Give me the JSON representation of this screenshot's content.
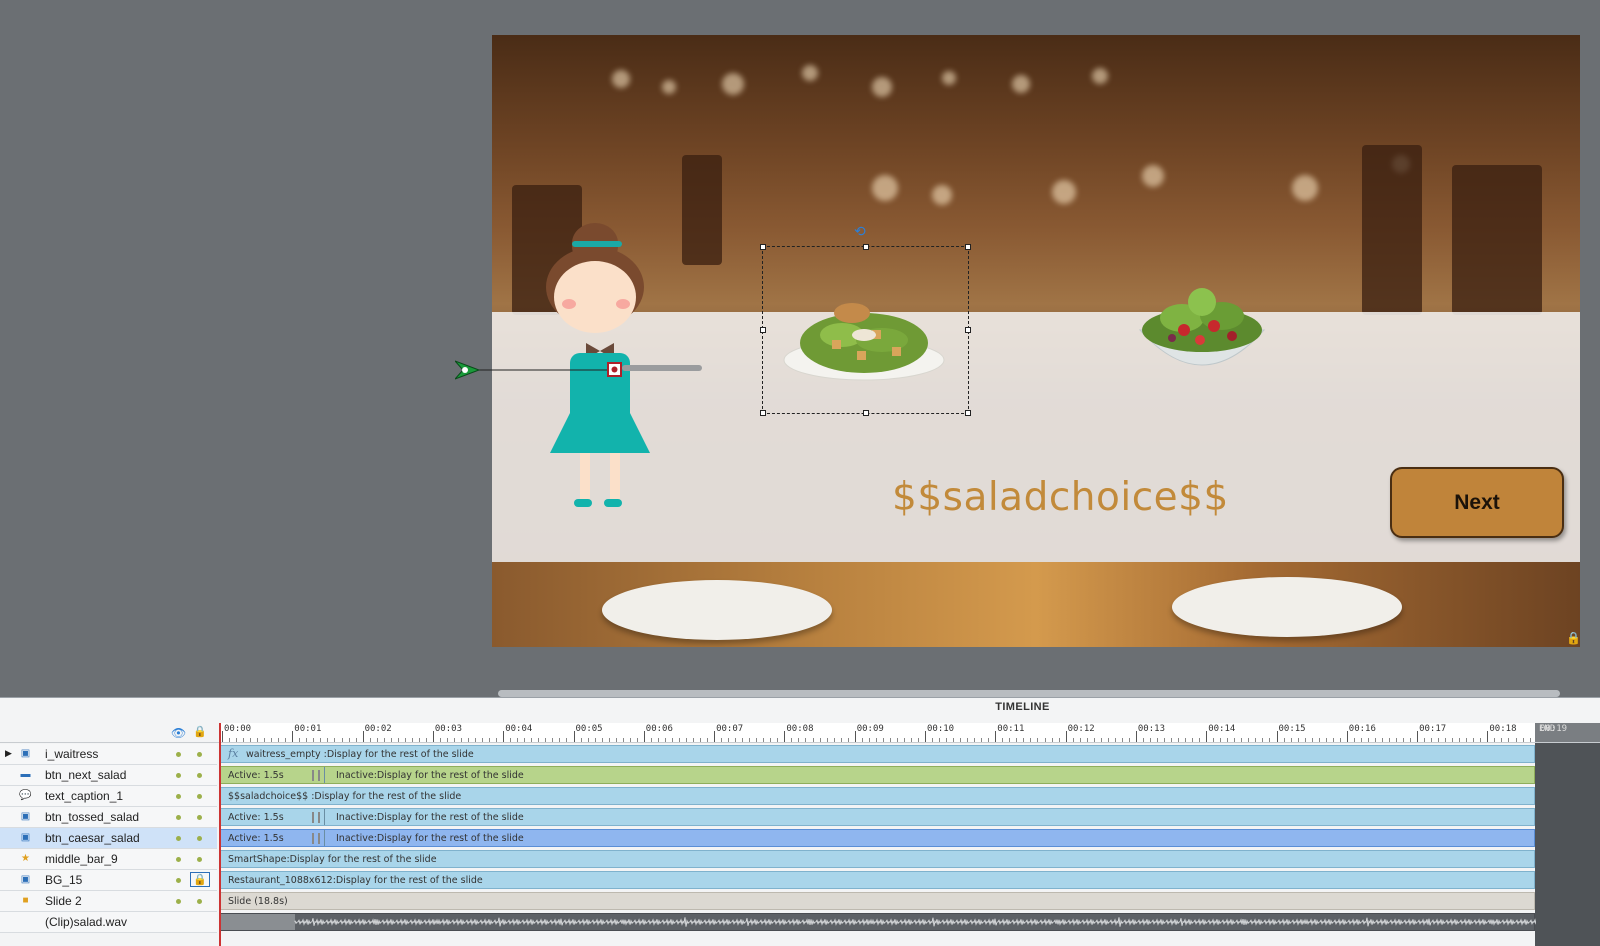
{
  "slide": {
    "caption_text": "$$saladchoice$$",
    "next_button_label": "Next"
  },
  "timeline": {
    "title": "TIMELINE",
    "ruler_labels": [
      "00:00",
      "00:01",
      "00:02",
      "00:03",
      "00:04",
      "00:05",
      "00:06",
      "00:07",
      "00:08",
      "00:09",
      "00:10",
      "00:11",
      "00:12",
      "00:13",
      "00:14",
      "00:15",
      "00:16",
      "00:17",
      "00:18",
      "00:19"
    ],
    "end_label": "END",
    "layers": [
      {
        "name": "i_waitress",
        "icon": "image-icon",
        "track": "waitress_empty :Display for the rest of the slide",
        "style": "blue",
        "fx": "fx"
      },
      {
        "name": "btn_next_salad",
        "icon": "button-icon",
        "active": "Active: 1.5s",
        "inactive": "Inactive:Display for the rest of the slide",
        "style": "green"
      },
      {
        "name": "text_caption_1",
        "icon": "caption-icon",
        "track": "$$saladchoice$$ :Display for the rest of the slide",
        "style": "blue"
      },
      {
        "name": "btn_tossed_salad",
        "icon": "image-icon",
        "active": "Active: 1.5s",
        "inactive": "Inactive:Display for the rest of the slide",
        "style": "blue"
      },
      {
        "name": "btn_caesar_salad",
        "icon": "image-icon",
        "active": "Active: 1.5s",
        "inactive": "Inactive:Display for the rest of the slide",
        "style": "blue-sel"
      },
      {
        "name": "middle_bar_9",
        "icon": "star-icon",
        "track": "SmartShape:Display for the rest of the slide",
        "style": "blue"
      },
      {
        "name": "BG_15",
        "icon": "image-icon",
        "track": "Restaurant_1088x612:Display for the rest of the slide",
        "style": "blue"
      },
      {
        "name": "Slide 2",
        "icon": "slide-icon",
        "track": "Slide (18.8s)",
        "style": "gray"
      },
      {
        "name": "(Clip)salad.wav",
        "icon": "",
        "track": "",
        "style": "audio"
      }
    ]
  },
  "colors": {
    "accent_blue": "#2c7fd6",
    "caption_gold": "#c28a3a",
    "next_button_bg": "#c0843a"
  }
}
